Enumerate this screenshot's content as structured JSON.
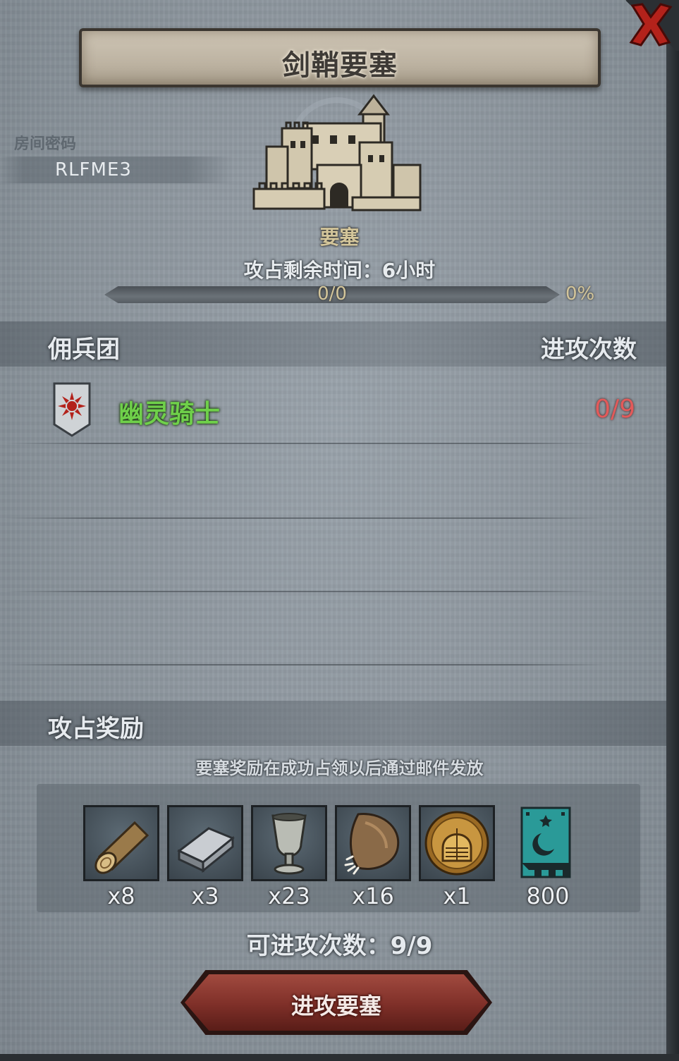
{
  "title": "剑鞘要塞",
  "room": {
    "label": "房间密码",
    "code": "RLFME3"
  },
  "fortress": {
    "type_label": "要塞",
    "time_label": "攻占剩余时间：",
    "time_value": "6小时",
    "progress_count": "0/0",
    "progress_percent": "0%",
    "progress_fraction": 0
  },
  "mercenary_section": {
    "title": "佣兵团",
    "attacks_header": "进攻次数",
    "rows": [
      {
        "name": "幽灵骑士",
        "attacks": "0/9",
        "emblem_icon": "red-sun-shield-icon"
      }
    ]
  },
  "rewards": {
    "title": "攻占奖励",
    "note": "要塞奖励在成功占领以后通过邮件发放",
    "items": [
      {
        "icon": "log-icon",
        "qty": "x8"
      },
      {
        "icon": "iron-ingot-icon",
        "qty": "x3"
      },
      {
        "icon": "goblet-icon",
        "qty": "x23"
      },
      {
        "icon": "fur-pelt-icon",
        "qty": "x16"
      },
      {
        "icon": "knight-helmet-coin-icon",
        "qty": "x1"
      },
      {
        "icon": "guild-banner-icon",
        "qty": "800"
      }
    ]
  },
  "attempts": {
    "label": "可进攻次数：",
    "value": "9/9"
  },
  "attack_button": {
    "label": "进攻要塞"
  },
  "colors": {
    "merc_name": "#6fd04a",
    "attacks_count": "#e25a5a",
    "button": "#7e2f28",
    "fortress_label": "#d3c59a"
  }
}
